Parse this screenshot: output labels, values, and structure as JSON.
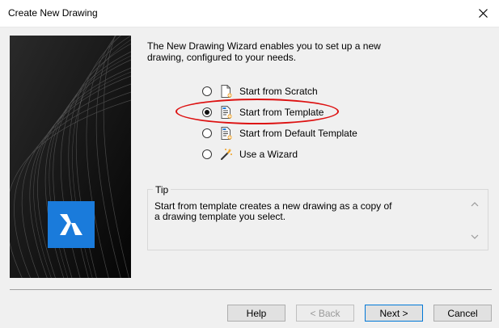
{
  "window": {
    "title": "Create New Drawing"
  },
  "intro_text": "The New Drawing Wizard enables you to set up a new drawing, configured to your needs.",
  "options": [
    {
      "label": "Start from Scratch",
      "checked": false,
      "icon": "blank-document-icon"
    },
    {
      "label": "Start from Template",
      "checked": true,
      "icon": "template-document-icon"
    },
    {
      "label": "Start from Default Template",
      "checked": false,
      "icon": "template-document-icon"
    },
    {
      "label": "Use a Wizard",
      "checked": false,
      "icon": "wizard-wand-icon"
    }
  ],
  "tip": {
    "legend": "Tip",
    "text": "Start from template creates a new drawing as a copy of a drawing template you select."
  },
  "buttons": {
    "help": "Help",
    "back": "< Back",
    "next": "Next >",
    "cancel": "Cancel"
  },
  "colors": {
    "logo_bg": "#1a7bdb",
    "highlight": "#dd1111",
    "default_button_border": "#0078d7"
  }
}
